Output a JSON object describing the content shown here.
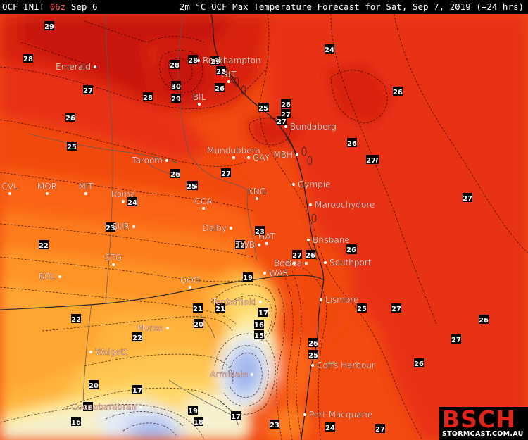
{
  "header": {
    "model": "OCF INIT",
    "init_time": "06z",
    "init_date": "Sep 6",
    "title": "2m °C OCF Max Temperature Forecast for Sat, Sep 7, 2019 (+24 hrs)"
  },
  "colors": {
    "c29": "#c8140f",
    "c28": "#d82010",
    "c27": "#e83012",
    "c26": "#f24a10",
    "c25": "#fa6414",
    "c24": "#fd7c1c",
    "c23": "#fe9426",
    "c22": "#ffa531",
    "c21": "#ffb43e",
    "c20": "#ffc651",
    "c19": "#ffd86a",
    "c18": "#ffe98e",
    "c17": "#f6f0cc",
    "c16": "#e4ebf6",
    "c15": "#c6d4f3",
    "c14": "#a2b8ee",
    "c13": "#7f98e6"
  },
  "places": [
    {
      "name": "Rockhampton"
    },
    {
      "name": "Emerald"
    },
    {
      "name": "BIL"
    },
    {
      "name": "GLT"
    },
    {
      "name": "Bundaberg"
    },
    {
      "name": "Mundubbera"
    },
    {
      "name": "MBH"
    },
    {
      "name": "GAY"
    },
    {
      "name": "Taroom"
    },
    {
      "name": "Gympie"
    },
    {
      "name": "CVL"
    },
    {
      "name": "MOR"
    },
    {
      "name": "MIT"
    },
    {
      "name": "Roma"
    },
    {
      "name": "KNG"
    },
    {
      "name": "CCA"
    },
    {
      "name": "Maroochydore"
    },
    {
      "name": "SUR"
    },
    {
      "name": "Dalby"
    },
    {
      "name": "GAT"
    },
    {
      "name": "Brisbane"
    },
    {
      "name": "TWB"
    },
    {
      "name": "Bea"
    },
    {
      "name": "Boo"
    },
    {
      "name": "Southport"
    },
    {
      "name": "STG"
    },
    {
      "name": "BOL"
    },
    {
      "name": "WAR"
    },
    {
      "name": "GOO"
    },
    {
      "name": "Lismore"
    },
    {
      "name": "Tenterfield"
    },
    {
      "name": "Moree"
    },
    {
      "name": "Walgett"
    },
    {
      "name": "Coffs Harbour"
    },
    {
      "name": "Armidale"
    },
    {
      "name": "Port Macquarie"
    },
    {
      "name": "Coonabarabran"
    }
  ],
  "labels": [
    {
      "value": "29"
    },
    {
      "value": "28"
    },
    {
      "value": "27"
    },
    {
      "value": "26"
    },
    {
      "value": "25"
    },
    {
      "value": "30"
    },
    {
      "value": "29"
    },
    {
      "value": "28"
    },
    {
      "value": "24"
    },
    {
      "value": "26"
    },
    {
      "value": "27"
    },
    {
      "value": "28"
    },
    {
      "value": "25"
    },
    {
      "value": "26"
    },
    {
      "value": "27"
    },
    {
      "value": "25"
    },
    {
      "value": "26"
    },
    {
      "value": "27"
    },
    {
      "value": "24"
    },
    {
      "value": "23"
    },
    {
      "value": "22"
    },
    {
      "value": "25"
    },
    {
      "value": "23"
    },
    {
      "value": "22"
    },
    {
      "value": "27"
    },
    {
      "value": "26"
    },
    {
      "value": "22"
    },
    {
      "value": "19"
    },
    {
      "value": "21"
    },
    {
      "value": "21"
    },
    {
      "value": "20"
    },
    {
      "value": "22"
    },
    {
      "value": "17"
    },
    {
      "value": "16"
    },
    {
      "value": "15"
    },
    {
      "value": "25"
    },
    {
      "value": "27"
    },
    {
      "value": "26"
    },
    {
      "value": "26"
    },
    {
      "value": "25"
    },
    {
      "value": "27"
    },
    {
      "value": "20"
    },
    {
      "value": "17"
    },
    {
      "value": "18"
    },
    {
      "value": "16"
    },
    {
      "value": "19"
    },
    {
      "value": "18"
    },
    {
      "value": "17"
    },
    {
      "value": "23"
    },
    {
      "value": "26"
    },
    {
      "value": "27"
    },
    {
      "value": "24"
    },
    {
      "value": "26"
    },
    {
      "value": "27"
    },
    {
      "value": "26"
    },
    {
      "value": "28"
    },
    {
      "value": "25"
    },
    {
      "value": "29"
    },
    {
      "value": "27"
    },
    {
      "value": "26"
    },
    {
      "value": "25"
    },
    {
      "value": "27"
    },
    {
      "value": "25"
    }
  ],
  "logo": {
    "big": "BSCH",
    "small": "STORMCAST.COM.AU"
  }
}
